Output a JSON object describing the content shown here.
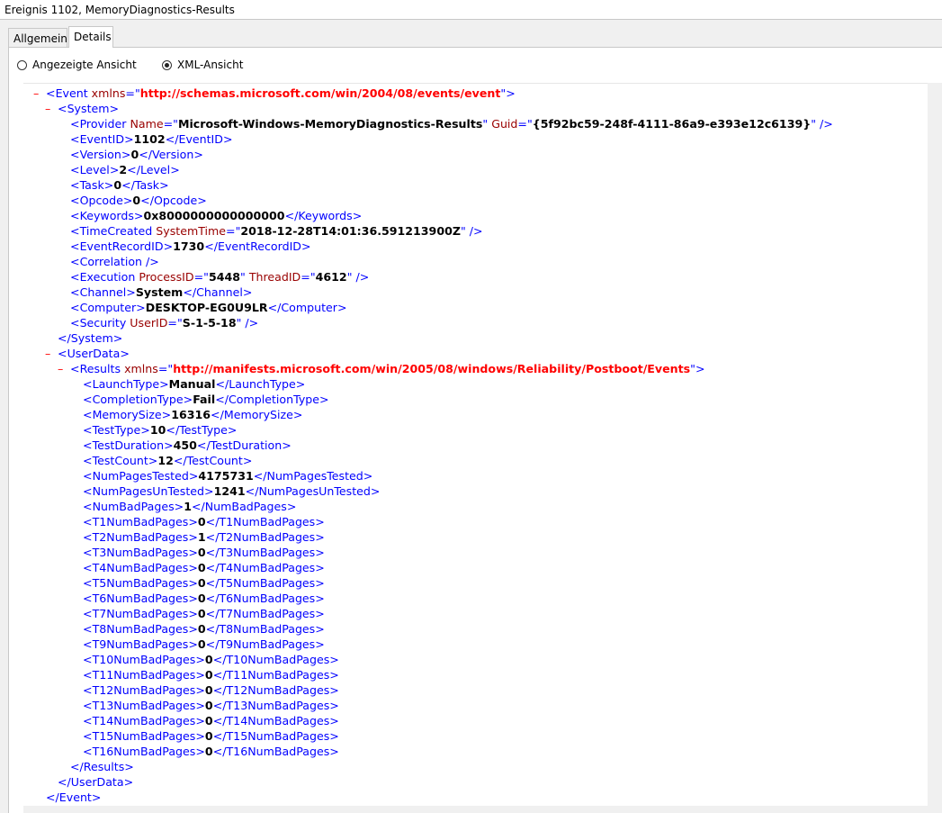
{
  "window": {
    "title": "Ereignis 1102, MemoryDiagnostics-Results"
  },
  "tabs": [
    {
      "label": "Allgemein",
      "active": false
    },
    {
      "label": "Details",
      "active": true
    }
  ],
  "view_options": {
    "friendly": {
      "label": "Angezeigte Ansicht",
      "checked": false
    },
    "xml": {
      "label": "XML-Ansicht",
      "checked": true
    }
  },
  "xml": {
    "collapse_symbol": "–",
    "event_tag": "Event",
    "event_attr": "xmlns",
    "event_ns": "http://schemas.microsoft.com/win/2004/08/events/event",
    "system_tag": "System",
    "provider": {
      "tag": "Provider",
      "name_attr": "Name",
      "name_value": "Microsoft-Windows-MemoryDiagnostics-Results",
      "guid_attr": "Guid",
      "guid_value": "{5f92bc59-248f-4111-86a9-e393e12c6139}"
    },
    "system_fields": [
      {
        "tag": "EventID",
        "value": "1102"
      },
      {
        "tag": "Version",
        "value": "0"
      },
      {
        "tag": "Level",
        "value": "2"
      },
      {
        "tag": "Task",
        "value": "0"
      },
      {
        "tag": "Opcode",
        "value": "0"
      },
      {
        "tag": "Keywords",
        "value": "0x8000000000000000"
      }
    ],
    "time_created": {
      "tag": "TimeCreated",
      "attr": "SystemTime",
      "value": "2018-12-28T14:01:36.591213900Z"
    },
    "event_record_id": {
      "tag": "EventRecordID",
      "value": "1730"
    },
    "correlation": {
      "tag": "Correlation"
    },
    "execution": {
      "tag": "Execution",
      "attr1": "ProcessID",
      "value1": "5448",
      "attr2": "ThreadID",
      "value2": "4612"
    },
    "channel": {
      "tag": "Channel",
      "value": "System"
    },
    "computer": {
      "tag": "Computer",
      "value": "DESKTOP-EG0U9LR"
    },
    "security": {
      "tag": "Security",
      "attr": "UserID",
      "value": "S-1-5-18"
    },
    "userdata_tag": "UserData",
    "results_tag": "Results",
    "results_attr": "xmlns",
    "results_ns": "http://manifests.microsoft.com/win/2005/08/windows/Reliability/Postboot/Events",
    "results_fields": [
      {
        "tag": "LaunchType",
        "value": "Manual"
      },
      {
        "tag": "CompletionType",
        "value": "Fail"
      },
      {
        "tag": "MemorySize",
        "value": "16316"
      },
      {
        "tag": "TestType",
        "value": "10"
      },
      {
        "tag": "TestDuration",
        "value": "450"
      },
      {
        "tag": "TestCount",
        "value": "12"
      },
      {
        "tag": "NumPagesTested",
        "value": "4175731"
      },
      {
        "tag": "NumPagesUnTested",
        "value": "1241"
      },
      {
        "tag": "NumBadPages",
        "value": "1"
      },
      {
        "tag": "T1NumBadPages",
        "value": "0"
      },
      {
        "tag": "T2NumBadPages",
        "value": "1"
      },
      {
        "tag": "T3NumBadPages",
        "value": "0"
      },
      {
        "tag": "T4NumBadPages",
        "value": "0"
      },
      {
        "tag": "T5NumBadPages",
        "value": "0"
      },
      {
        "tag": "T6NumBadPages",
        "value": "0"
      },
      {
        "tag": "T7NumBadPages",
        "value": "0"
      },
      {
        "tag": "T8NumBadPages",
        "value": "0"
      },
      {
        "tag": "T9NumBadPages",
        "value": "0"
      },
      {
        "tag": "T10NumBadPages",
        "value": "0"
      },
      {
        "tag": "T11NumBadPages",
        "value": "0"
      },
      {
        "tag": "T12NumBadPages",
        "value": "0"
      },
      {
        "tag": "T13NumBadPages",
        "value": "0"
      },
      {
        "tag": "T14NumBadPages",
        "value": "0"
      },
      {
        "tag": "T15NumBadPages",
        "value": "0"
      },
      {
        "tag": "T16NumBadPages",
        "value": "0"
      }
    ]
  }
}
